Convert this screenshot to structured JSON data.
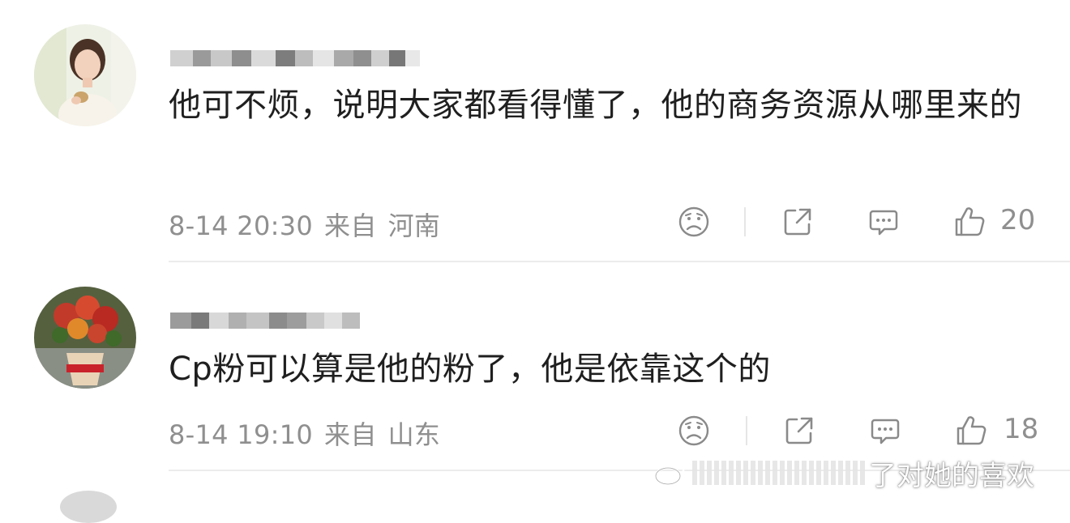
{
  "comments": [
    {
      "username": "",
      "text": "他可不烦，说明大家都看得懂了，他的商务资源从哪里来的",
      "time": "8-14 20:30",
      "from_label": "来自",
      "location": "河南",
      "like_count": "20"
    },
    {
      "username": "",
      "text": "Cp粉可以算是他的粉了，他是依靠这个的",
      "time": "8-14 19:10",
      "from_label": "来自",
      "location": "山东",
      "like_count": "18"
    }
  ],
  "watermark": {
    "text": "了对她的喜欢"
  },
  "icons": {
    "dislike": "frown-face-icon",
    "repost": "share-out-icon",
    "comment": "comment-bubble-icon",
    "like": "thumbs-up-icon"
  },
  "colors": {
    "meta_text": "#8f8f8f",
    "divider": "#ececec",
    "body_text": "#1f1f1f"
  }
}
